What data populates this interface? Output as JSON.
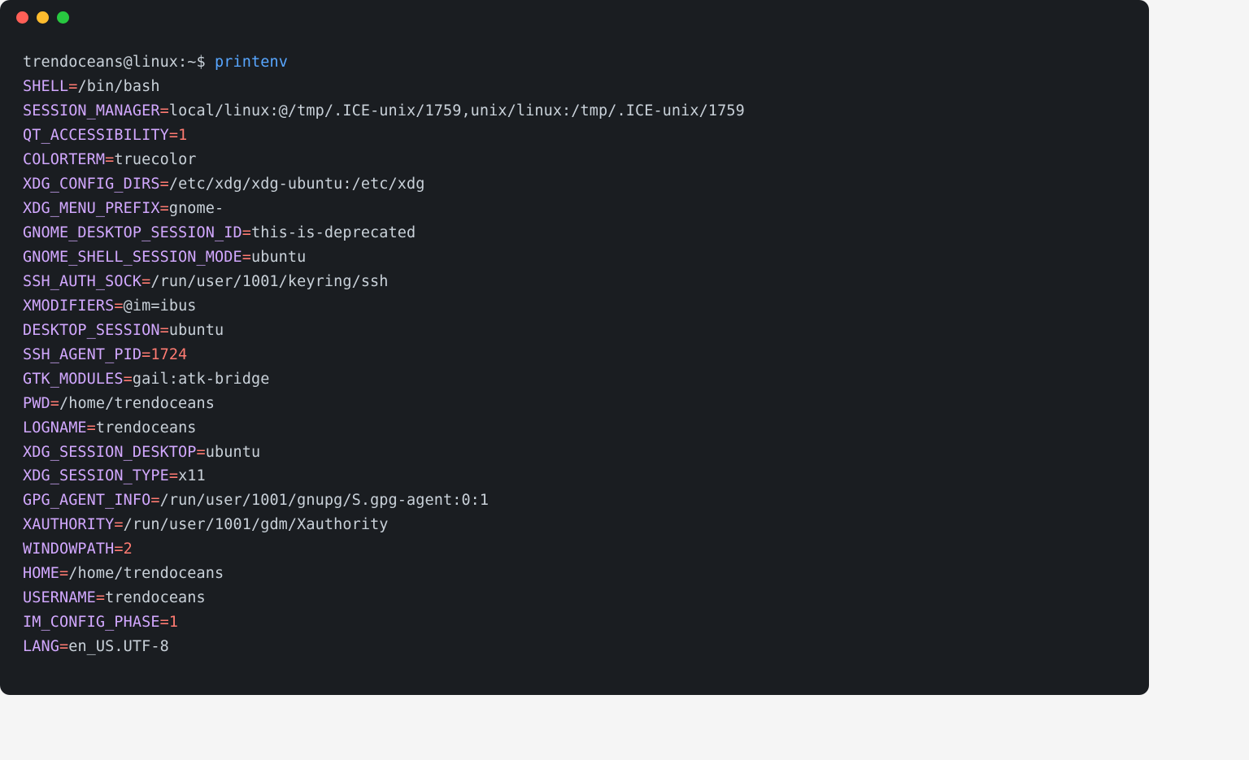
{
  "prompt": {
    "user_host_path": "trendoceans@linux:~",
    "dollar": "$",
    "command": "printenv"
  },
  "env": [
    {
      "key": "SHELL",
      "value": "/bin/bash",
      "numeric": false
    },
    {
      "key": "SESSION_MANAGER",
      "value": "local/linux:@/tmp/.ICE-unix/1759,unix/linux:/tmp/.ICE-unix/1759",
      "numeric": false
    },
    {
      "key": "QT_ACCESSIBILITY",
      "value": "1",
      "numeric": true
    },
    {
      "key": "COLORTERM",
      "value": "truecolor",
      "numeric": false
    },
    {
      "key": "XDG_CONFIG_DIRS",
      "value": "/etc/xdg/xdg-ubuntu:/etc/xdg",
      "numeric": false
    },
    {
      "key": "XDG_MENU_PREFIX",
      "value": "gnome-",
      "numeric": false
    },
    {
      "key": "GNOME_DESKTOP_SESSION_ID",
      "value": "this-is-deprecated",
      "numeric": false
    },
    {
      "key": "GNOME_SHELL_SESSION_MODE",
      "value": "ubuntu",
      "numeric": false
    },
    {
      "key": "SSH_AUTH_SOCK",
      "value": "/run/user/1001/keyring/ssh",
      "numeric": false
    },
    {
      "key": "XMODIFIERS",
      "value": "@im=ibus",
      "numeric": false
    },
    {
      "key": "DESKTOP_SESSION",
      "value": "ubuntu",
      "numeric": false
    },
    {
      "key": "SSH_AGENT_PID",
      "value": "1724",
      "numeric": true
    },
    {
      "key": "GTK_MODULES",
      "value": "gail:atk-bridge",
      "numeric": false
    },
    {
      "key": "PWD",
      "value": "/home/trendoceans",
      "numeric": false
    },
    {
      "key": "LOGNAME",
      "value": "trendoceans",
      "numeric": false
    },
    {
      "key": "XDG_SESSION_DESKTOP",
      "value": "ubuntu",
      "numeric": false
    },
    {
      "key": "XDG_SESSION_TYPE",
      "value": "x11",
      "numeric": false
    },
    {
      "key": "GPG_AGENT_INFO",
      "value": "/run/user/1001/gnupg/S.gpg-agent:0:1",
      "numeric": false
    },
    {
      "key": "XAUTHORITY",
      "value": "/run/user/1001/gdm/Xauthority",
      "numeric": false
    },
    {
      "key": "WINDOWPATH",
      "value": "2",
      "numeric": true
    },
    {
      "key": "HOME",
      "value": "/home/trendoceans",
      "numeric": false
    },
    {
      "key": "USERNAME",
      "value": "trendoceans",
      "numeric": false
    },
    {
      "key": "IM_CONFIG_PHASE",
      "value": "1",
      "numeric": true
    },
    {
      "key": "LANG",
      "value": "en_US.UTF-8",
      "numeric": false
    }
  ]
}
